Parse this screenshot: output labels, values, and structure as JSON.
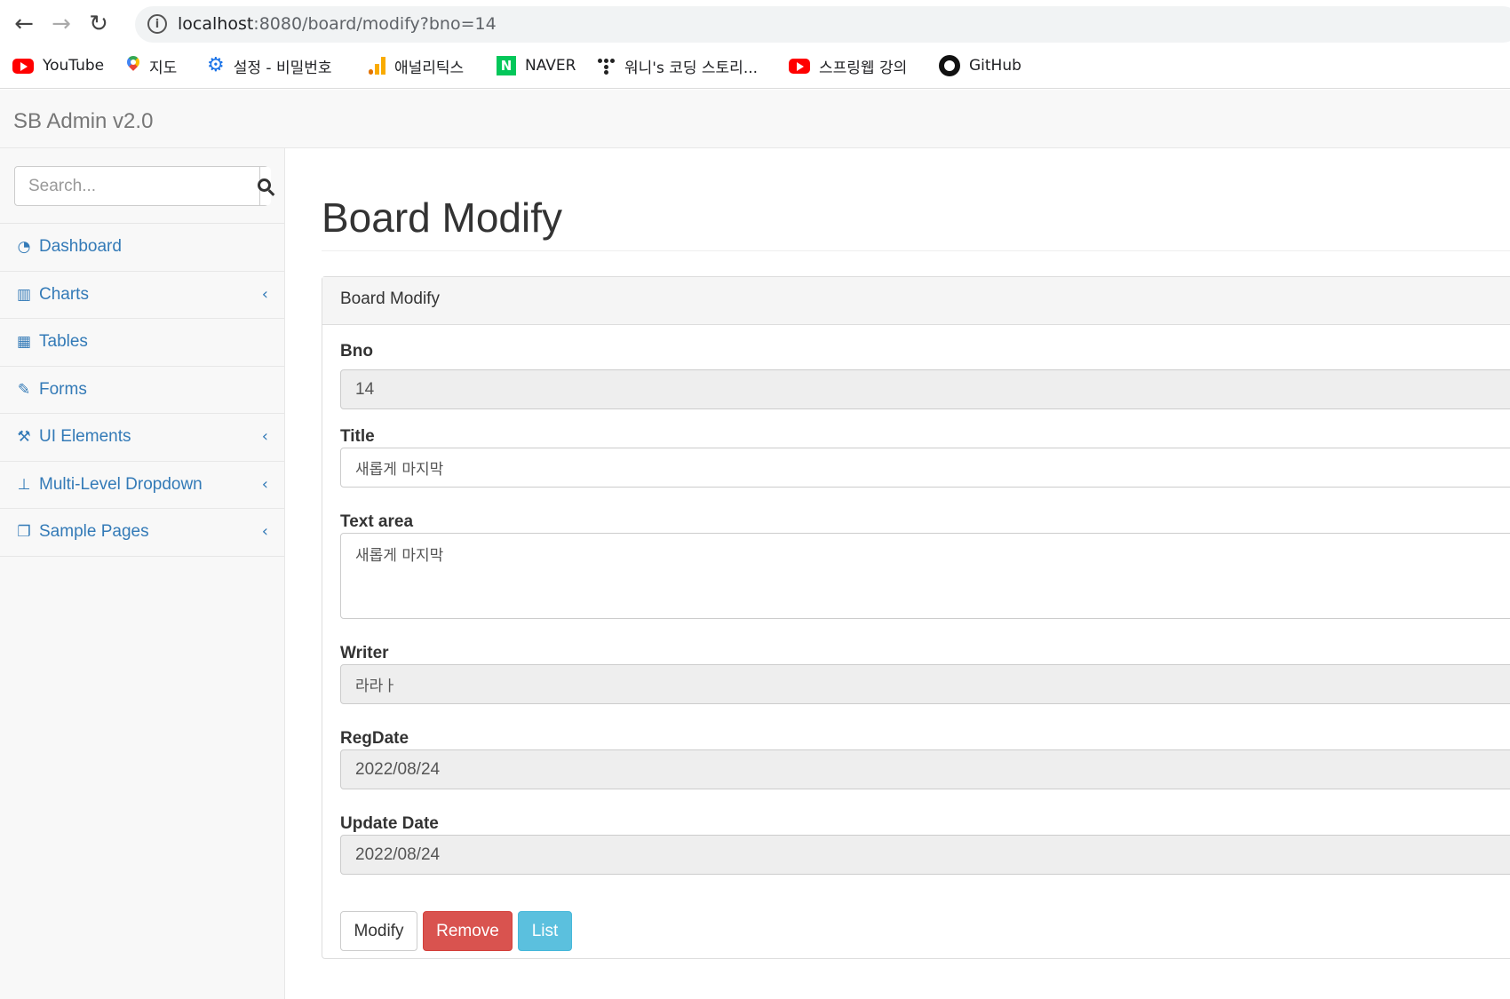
{
  "browser": {
    "url_host": "localhost",
    "url_path": ":8080/board/modify?bno=14",
    "bookmarks": [
      {
        "label": "YouTube",
        "icon": "youtube-icon"
      },
      {
        "label": "지도",
        "icon": "maps-pin-icon"
      },
      {
        "label": "설정 - 비밀번호",
        "icon": "gear-icon"
      },
      {
        "label": "애널리틱스",
        "icon": "analytics-icon"
      },
      {
        "label": "NAVER",
        "icon": "naver-icon"
      },
      {
        "label": "워니's 코딩 스토리...",
        "icon": "dots-icon"
      },
      {
        "label": "스프링웹 강의",
        "icon": "youtube-icon"
      },
      {
        "label": "GitHub",
        "icon": "github-icon"
      }
    ]
  },
  "app": {
    "brand": "SB Admin v2.0"
  },
  "sidebar": {
    "search_placeholder": "Search...",
    "items": [
      {
        "label": "Dashboard",
        "icon": "dashboard-icon",
        "has_arrow": false
      },
      {
        "label": "Charts",
        "icon": "bar-chart-icon",
        "has_arrow": true
      },
      {
        "label": "Tables",
        "icon": "table-icon",
        "has_arrow": false
      },
      {
        "label": "Forms",
        "icon": "edit-icon",
        "has_arrow": false
      },
      {
        "label": "UI Elements",
        "icon": "wrench-icon",
        "has_arrow": true
      },
      {
        "label": "Multi-Level Dropdown",
        "icon": "sitemap-icon",
        "has_arrow": true
      },
      {
        "label": "Sample Pages",
        "icon": "files-icon",
        "has_arrow": true
      }
    ],
    "arrow_glyph": "‹"
  },
  "main": {
    "title": "Board Modify",
    "panel_heading": "Board Modify",
    "fields": {
      "bno": {
        "label": "Bno",
        "value": "14"
      },
      "title": {
        "label": "Title",
        "value": "새롭게 마지막"
      },
      "content": {
        "label": "Text area",
        "value": "새롭게 마지막"
      },
      "writer": {
        "label": "Writer",
        "value": "라라ㅏ"
      },
      "regdate": {
        "label": "RegDate",
        "value": "2022/08/24"
      },
      "updatedate": {
        "label": "Update Date",
        "value": "2022/08/24"
      }
    },
    "buttons": {
      "modify": "Modify",
      "remove": "Remove",
      "list": "List"
    }
  },
  "colors": {
    "link": "#337ab7",
    "danger": "#d9534f",
    "info": "#5bc0de"
  }
}
